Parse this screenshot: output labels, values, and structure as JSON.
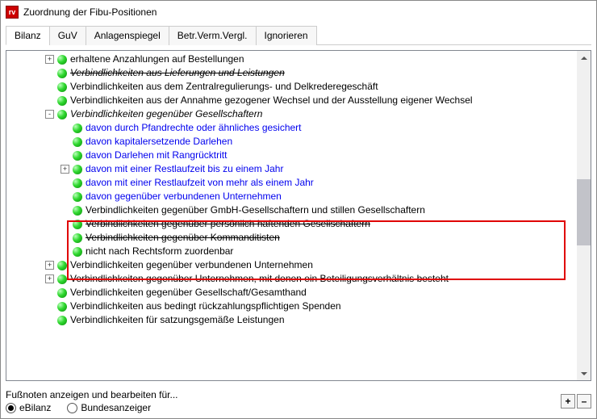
{
  "window": {
    "title": "Zuordnung der Fibu-Positionen"
  },
  "tabs": [
    "Bilanz",
    "GuV",
    "Anlagenspiegel",
    "Betr.Verm.Vergl.",
    "Ignorieren"
  ],
  "active_tab": 0,
  "tree": [
    {
      "indent": 1,
      "expander": "+",
      "text": "erhaltene Anzahlungen auf Bestellungen",
      "style": ""
    },
    {
      "indent": 1,
      "expander": "",
      "text": "Verbindlichkeiten aus Lieferungen und Leistungen",
      "style": "italic strike"
    },
    {
      "indent": 1,
      "expander": "",
      "text": "Verbindlichkeiten aus dem Zentralregulierungs- und Delkrederegeschäft",
      "style": ""
    },
    {
      "indent": 1,
      "expander": "",
      "text": "Verbindlichkeiten aus der Annahme gezogener Wechsel und der Ausstellung eigener Wechsel",
      "style": ""
    },
    {
      "indent": 1,
      "expander": "-",
      "text": "Verbindlichkeiten gegenüber Gesellschaftern",
      "style": "italic"
    },
    {
      "indent": 2,
      "expander": "",
      "text": "davon durch Pfandrechte oder ähnliches gesichert",
      "style": "blue"
    },
    {
      "indent": 2,
      "expander": "",
      "text": "davon kapitalersetzende Darlehen",
      "style": "blue"
    },
    {
      "indent": 2,
      "expander": "",
      "text": "davon Darlehen mit Rangrücktritt",
      "style": "blue"
    },
    {
      "indent": 2,
      "expander": "+",
      "text": "davon mit einer Restlaufzeit bis zu einem Jahr",
      "style": "blue"
    },
    {
      "indent": 2,
      "expander": "",
      "text": "davon mit einer Restlaufzeit von mehr als einem Jahr",
      "style": "blue"
    },
    {
      "indent": 2,
      "expander": "",
      "text": "davon gegenüber verbundenen Unternehmen",
      "style": "blue"
    },
    {
      "indent": 2,
      "expander": "",
      "text": "Verbindlichkeiten gegenüber GmbH-Gesellschaftern und stillen Gesellschaftern",
      "style": ""
    },
    {
      "indent": 2,
      "expander": "",
      "text": "Verbindlichkeiten gegenüber persönlich haftenden Gesellschaftern",
      "style": "strike"
    },
    {
      "indent": 2,
      "expander": "",
      "text": "Verbindlichkeiten gegenüber Kommanditisten",
      "style": "strike"
    },
    {
      "indent": 2,
      "expander": "",
      "text": "nicht nach Rechtsform zuordenbar",
      "style": ""
    },
    {
      "indent": 1,
      "expander": "+",
      "text": "Verbindlichkeiten gegenüber verbundenen Unternehmen",
      "style": ""
    },
    {
      "indent": 1,
      "expander": "+",
      "text": "Verbindlichkeiten gegenüber Unternehmen, mit denen ein Beteiligungsverhältnis besteht",
      "style": ""
    },
    {
      "indent": 1,
      "expander": "",
      "text": "Verbindlichkeiten gegenüber Gesellschaft/Gesamthand",
      "style": ""
    },
    {
      "indent": 1,
      "expander": "",
      "text": "Verbindlichkeiten aus bedingt rückzahlungspflichtigen Spenden",
      "style": ""
    },
    {
      "indent": 1,
      "expander": "",
      "text": "Verbindlichkeiten für satzungsgemäße Leistungen",
      "style": ""
    }
  ],
  "footer": {
    "label": "Fußnoten anzeigen und bearbeiten für...",
    "radios": [
      "eBilanz",
      "Bundesanzeiger"
    ],
    "selected_radio": 0,
    "buttons": [
      "+",
      "–"
    ]
  }
}
